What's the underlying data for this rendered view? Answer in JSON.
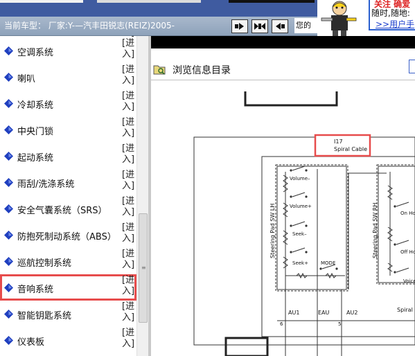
{
  "header": {
    "car_type": "当前车型：  厂家:Y-—汽丰田锐志(REIZ)2005-",
    "nav_buttons": [
      "◆▶",
      "▶◀▶",
      "◀◆"
    ],
    "partial_text": "您的"
  },
  "ad": {
    "line1": "关注   确爱",
    "line2": "随时,随地:",
    "line3": ">>用户手"
  },
  "sidebar": {
    "items": [
      {
        "label": "空调系统",
        "action": "[进\n入]"
      },
      {
        "label": "喇叭",
        "action": "[进\n入]"
      },
      {
        "label": "冷却系统",
        "action": "[进\n入]"
      },
      {
        "label": "中央门锁",
        "action": "[进\n入]"
      },
      {
        "label": "起动系统",
        "action": "[进\n入]"
      },
      {
        "label": "雨刮/洗涤系统",
        "action": "[进\n入]"
      },
      {
        "label": "安全气囊系统（SRS）",
        "action": "[进\n入]"
      },
      {
        "label": "防抱死制动系统（ABS）",
        "action": "[进\n入]"
      },
      {
        "label": "巡航控制系统",
        "action": "[进\n入]"
      },
      {
        "label": "音响系统",
        "action": "[进\n入]"
      },
      {
        "label": "智能钥匙系统",
        "action": "[进\n入]"
      },
      {
        "label": "仪表板",
        "action": "[进\n入]"
      }
    ],
    "selected_index": 9,
    "partial_top": "入]"
  },
  "main": {
    "browse_title": "浏览信息目录",
    "diagram": {
      "component_id": "I17",
      "component_name": "Spiral Cable",
      "left_pad": "Steering Pad SW LH",
      "right_pad": "Steering Pad SW RH",
      "switches_left": [
        "Volume–",
        "Volume+",
        "Seek–",
        "Seek+",
        "MODE"
      ],
      "switches_right": [
        "On Ho",
        "Off Ho",
        "Voice"
      ],
      "bottom_labels": [
        "AU1",
        "EAU",
        "AU2",
        "Spiral C"
      ],
      "pin_numbers": [
        "6",
        "5"
      ]
    }
  },
  "colors": {
    "highlight": "#e74c4c",
    "header_bar": "#9aadc3",
    "icon_blue": "#1f3fbf"
  }
}
